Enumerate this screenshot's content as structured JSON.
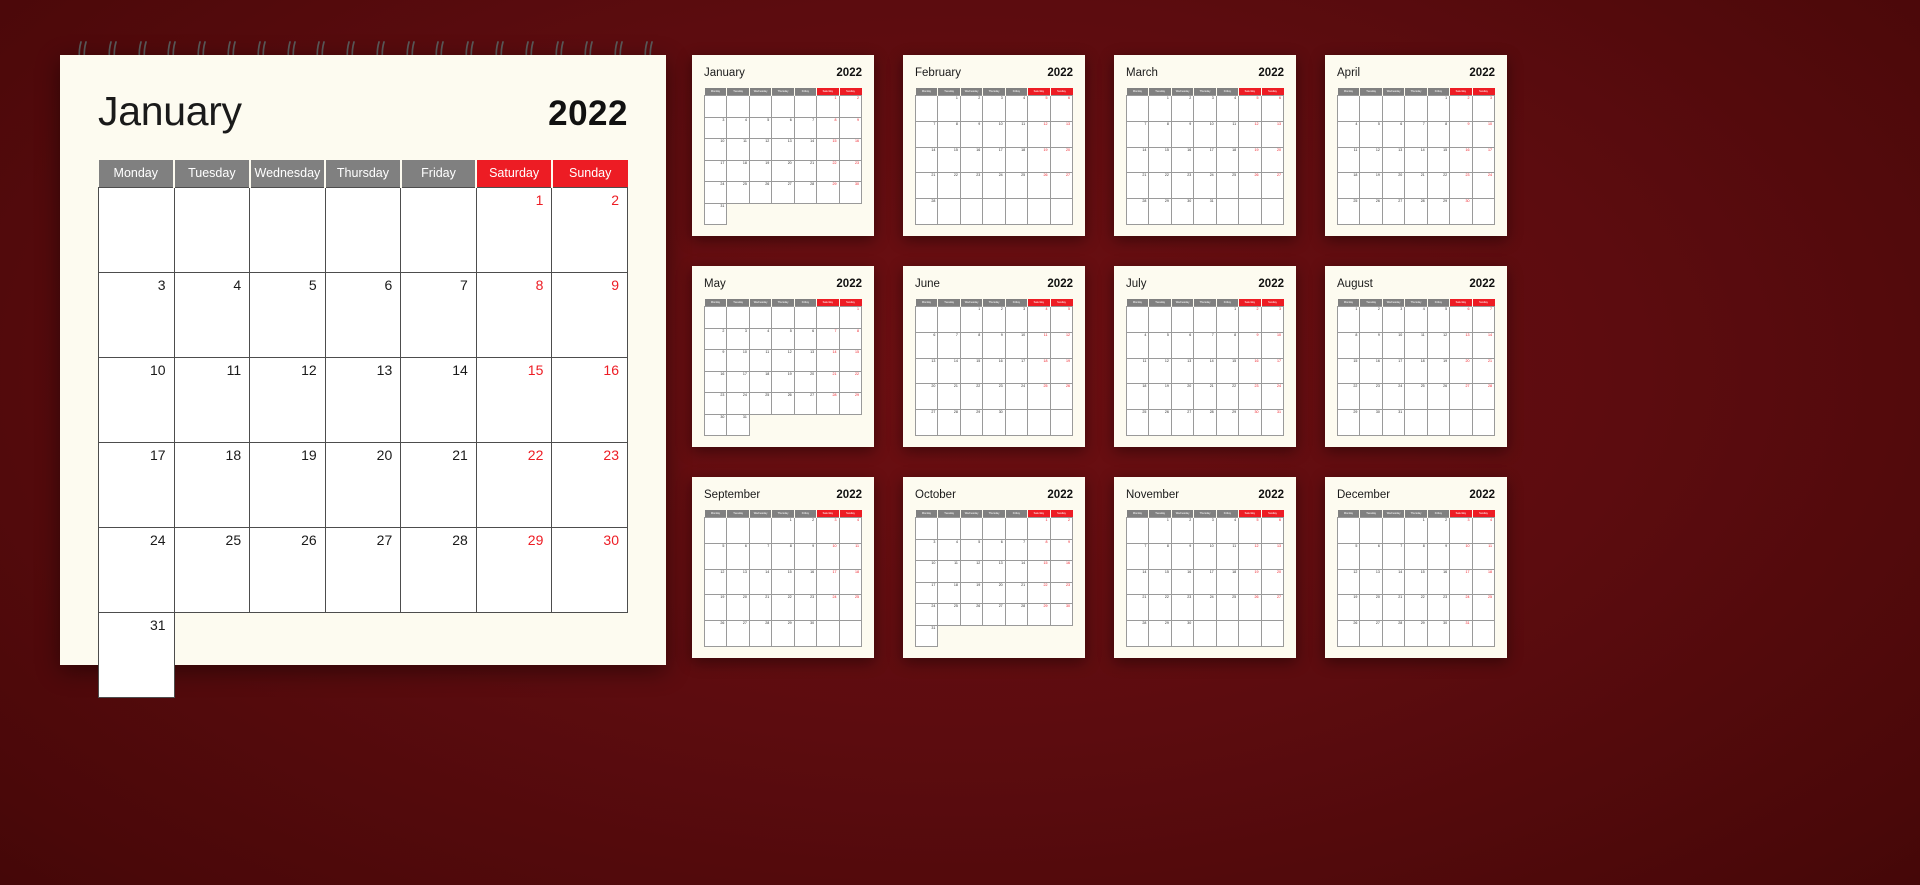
{
  "year": "2022",
  "colors": {
    "background_dark": "#4a0809",
    "paper": "#fdfbf0",
    "weekday_header": "#808080",
    "weekend_header": "#ed1c24",
    "weekend_text": "#ed1c24"
  },
  "weekdays": [
    "Monday",
    "Tuesday",
    "Wednesday",
    "Thursday",
    "Friday",
    "Saturday",
    "Sunday"
  ],
  "main": {
    "month": "January",
    "year": "2022",
    "weeks": [
      [
        "",
        "",
        "",
        "",
        "",
        "1",
        "2"
      ],
      [
        "3",
        "4",
        "5",
        "6",
        "7",
        "8",
        "9"
      ],
      [
        "10",
        "11",
        "12",
        "13",
        "14",
        "15",
        "16"
      ],
      [
        "17",
        "18",
        "19",
        "20",
        "21",
        "22",
        "23"
      ],
      [
        "24",
        "25",
        "26",
        "27",
        "28",
        "29",
        "30"
      ],
      [
        "31",
        "",
        "",
        "",
        "",
        "",
        ""
      ]
    ]
  },
  "months": [
    {
      "name": "January",
      "year": "2022",
      "weeks": [
        [
          "",
          "",
          "",
          "",
          "",
          "1",
          "2"
        ],
        [
          "3",
          "4",
          "5",
          "6",
          "7",
          "8",
          "9"
        ],
        [
          "10",
          "11",
          "12",
          "13",
          "14",
          "15",
          "16"
        ],
        [
          "17",
          "18",
          "19",
          "20",
          "21",
          "22",
          "23"
        ],
        [
          "24",
          "25",
          "26",
          "27",
          "28",
          "29",
          "30"
        ],
        [
          "31",
          "",
          "",
          "",
          "",
          "",
          ""
        ]
      ]
    },
    {
      "name": "February",
      "year": "2022",
      "weeks": [
        [
          "",
          "1",
          "2",
          "3",
          "4",
          "5",
          "6"
        ],
        [
          "7",
          "8",
          "9",
          "10",
          "11",
          "12",
          "13"
        ],
        [
          "14",
          "15",
          "16",
          "17",
          "18",
          "19",
          "20"
        ],
        [
          "21",
          "22",
          "23",
          "24",
          "25",
          "26",
          "27"
        ],
        [
          "28",
          "",
          "",
          "",
          "",
          "",
          ""
        ]
      ]
    },
    {
      "name": "March",
      "year": "2022",
      "weeks": [
        [
          "",
          "1",
          "2",
          "3",
          "4",
          "5",
          "6"
        ],
        [
          "7",
          "8",
          "9",
          "10",
          "11",
          "12",
          "13"
        ],
        [
          "14",
          "15",
          "16",
          "17",
          "18",
          "19",
          "20"
        ],
        [
          "21",
          "22",
          "23",
          "24",
          "25",
          "26",
          "27"
        ],
        [
          "28",
          "29",
          "30",
          "31",
          "",
          "",
          ""
        ]
      ]
    },
    {
      "name": "April",
      "year": "2022",
      "weeks": [
        [
          "",
          "",
          "",
          "",
          "1",
          "2",
          "3"
        ],
        [
          "4",
          "5",
          "6",
          "7",
          "8",
          "9",
          "10"
        ],
        [
          "11",
          "12",
          "13",
          "14",
          "15",
          "16",
          "17"
        ],
        [
          "18",
          "19",
          "20",
          "21",
          "22",
          "23",
          "24"
        ],
        [
          "25",
          "26",
          "27",
          "28",
          "29",
          "30",
          ""
        ]
      ]
    },
    {
      "name": "May",
      "year": "2022",
      "weeks": [
        [
          "",
          "",
          "",
          "",
          "",
          "",
          "1"
        ],
        [
          "2",
          "3",
          "4",
          "5",
          "6",
          "7",
          "8"
        ],
        [
          "9",
          "10",
          "11",
          "12",
          "13",
          "14",
          "15"
        ],
        [
          "16",
          "17",
          "18",
          "19",
          "20",
          "21",
          "22"
        ],
        [
          "23",
          "24",
          "25",
          "26",
          "27",
          "28",
          "29"
        ],
        [
          "30",
          "31",
          "",
          "",
          "",
          "",
          ""
        ]
      ]
    },
    {
      "name": "June",
      "year": "2022",
      "weeks": [
        [
          "",
          "",
          "1",
          "2",
          "3",
          "4",
          "5"
        ],
        [
          "6",
          "7",
          "8",
          "9",
          "10",
          "11",
          "12"
        ],
        [
          "13",
          "14",
          "15",
          "16",
          "17",
          "18",
          "19"
        ],
        [
          "20",
          "21",
          "22",
          "23",
          "24",
          "25",
          "26"
        ],
        [
          "27",
          "28",
          "29",
          "30",
          "",
          "",
          ""
        ]
      ]
    },
    {
      "name": "July",
      "year": "2022",
      "weeks": [
        [
          "",
          "",
          "",
          "",
          "1",
          "2",
          "3"
        ],
        [
          "4",
          "5",
          "6",
          "7",
          "8",
          "9",
          "10"
        ],
        [
          "11",
          "12",
          "13",
          "14",
          "15",
          "16",
          "17"
        ],
        [
          "18",
          "19",
          "20",
          "21",
          "22",
          "23",
          "24"
        ],
        [
          "25",
          "26",
          "27",
          "28",
          "29",
          "30",
          "31"
        ]
      ]
    },
    {
      "name": "August",
      "year": "2022",
      "weeks": [
        [
          "1",
          "2",
          "3",
          "4",
          "5",
          "6",
          "7"
        ],
        [
          "8",
          "9",
          "10",
          "11",
          "12",
          "13",
          "14"
        ],
        [
          "15",
          "16",
          "17",
          "18",
          "19",
          "20",
          "21"
        ],
        [
          "22",
          "23",
          "24",
          "25",
          "26",
          "27",
          "28"
        ],
        [
          "29",
          "30",
          "31",
          "",
          "",
          "",
          ""
        ]
      ]
    },
    {
      "name": "September",
      "year": "2022",
      "weeks": [
        [
          "",
          "",
          "",
          "1",
          "2",
          "3",
          "4"
        ],
        [
          "5",
          "6",
          "7",
          "8",
          "9",
          "10",
          "11"
        ],
        [
          "12",
          "13",
          "14",
          "15",
          "16",
          "17",
          "18"
        ],
        [
          "19",
          "20",
          "21",
          "22",
          "23",
          "24",
          "25"
        ],
        [
          "26",
          "27",
          "28",
          "29",
          "30",
          "",
          ""
        ]
      ]
    },
    {
      "name": "October",
      "year": "2022",
      "weeks": [
        [
          "",
          "",
          "",
          "",
          "",
          "1",
          "2"
        ],
        [
          "3",
          "4",
          "5",
          "6",
          "7",
          "8",
          "9"
        ],
        [
          "10",
          "11",
          "12",
          "13",
          "14",
          "15",
          "16"
        ],
        [
          "17",
          "18",
          "19",
          "20",
          "21",
          "22",
          "23"
        ],
        [
          "24",
          "25",
          "26",
          "27",
          "28",
          "29",
          "30"
        ],
        [
          "31",
          "",
          "",
          "",
          "",
          "",
          ""
        ]
      ]
    },
    {
      "name": "November",
      "year": "2022",
      "weeks": [
        [
          "",
          "1",
          "2",
          "3",
          "4",
          "5",
          "6"
        ],
        [
          "7",
          "8",
          "9",
          "10",
          "11",
          "12",
          "13"
        ],
        [
          "14",
          "15",
          "16",
          "17",
          "18",
          "19",
          "20"
        ],
        [
          "21",
          "22",
          "23",
          "24",
          "25",
          "26",
          "27"
        ],
        [
          "28",
          "29",
          "30",
          "",
          "",
          "",
          ""
        ]
      ]
    },
    {
      "name": "December",
      "year": "2022",
      "weeks": [
        [
          "",
          "",
          "",
          "1",
          "2",
          "3",
          "4"
        ],
        [
          "5",
          "6",
          "7",
          "8",
          "9",
          "10",
          "11"
        ],
        [
          "12",
          "13",
          "14",
          "15",
          "16",
          "17",
          "18"
        ],
        [
          "19",
          "20",
          "21",
          "22",
          "23",
          "24",
          "25"
        ],
        [
          "26",
          "27",
          "28",
          "29",
          "30",
          "31",
          ""
        ]
      ]
    }
  ]
}
